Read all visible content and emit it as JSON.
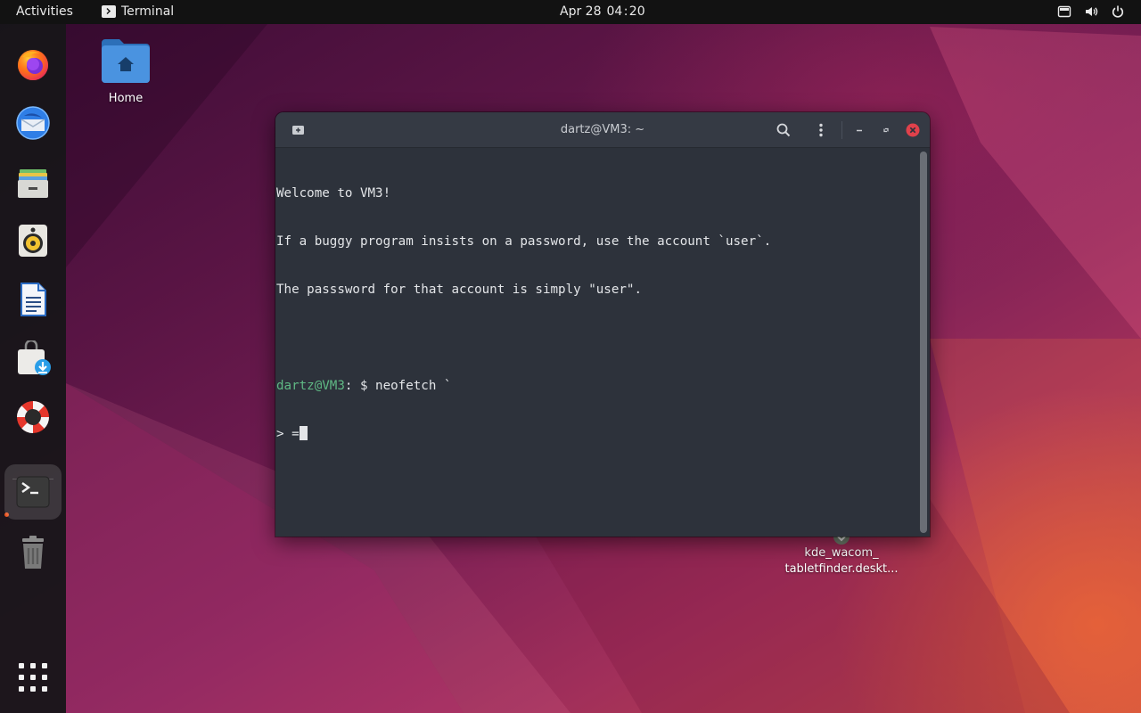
{
  "topbar": {
    "activities": "Activities",
    "app_name": "Terminal",
    "date": "Apr 28",
    "time": "04 : 20",
    "tray_icons": [
      "screen-icon",
      "volume-icon",
      "power-icon"
    ]
  },
  "dock": {
    "apps": [
      {
        "name": "Firefox",
        "icon": "firefox-icon"
      },
      {
        "name": "Thunderbird",
        "icon": "thunderbird-icon"
      },
      {
        "name": "Files",
        "icon": "files-icon"
      },
      {
        "name": "Rhythmbox",
        "icon": "rhythmbox-icon"
      },
      {
        "name": "LibreOffice Writer",
        "icon": "writer-icon"
      },
      {
        "name": "Ubuntu Software",
        "icon": "software-icon"
      },
      {
        "name": "Help",
        "icon": "help-icon"
      },
      {
        "name": "Terminal",
        "icon": "terminal-icon",
        "active": true
      },
      {
        "name": "Trash",
        "icon": "trash-icon"
      },
      {
        "name": "Show Applications",
        "icon": "app-grid-icon"
      }
    ]
  },
  "desktop": {
    "home_label": "Home",
    "kde_label_line1": "kde_wacom_",
    "kde_label_line2": "tabletfinder.deskt..."
  },
  "terminal": {
    "title": "dartz@VM3: ~",
    "lines": {
      "l1": "Welcome to VM3!",
      "l2": "If a buggy program insists on a password, use the account `user`.",
      "l3": "The passsword for that account is simply \"user\".",
      "prompt_user": "dartz@VM3",
      "prompt_rest": ": $ neofetch `",
      "cont": "> ="
    }
  },
  "colors": {
    "accent": "#e95420",
    "prompt_green": "#5fb884",
    "terminal_bg": "#2d323b",
    "close_red": "#e0414b"
  }
}
